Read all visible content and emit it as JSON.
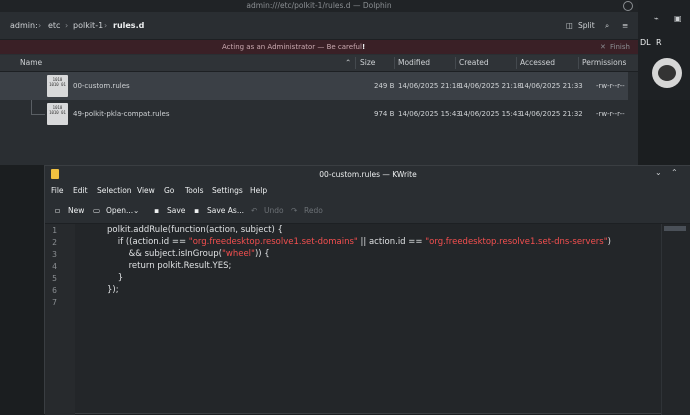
{
  "dolphin": {
    "title": "admin:///etc/polkit-1/rules.d — Dolphin",
    "breadcrumb": [
      "admin:",
      "etc",
      "polkit-1",
      "rules.d"
    ],
    "split_label": "Split",
    "admin_warning": "Acting as an Administrator — Be careful!",
    "finish_label": "Finish",
    "columns": [
      "Name",
      "Size",
      "Modified",
      "Created",
      "Accessed",
      "Permissions"
    ],
    "files": [
      {
        "name": "00-custom.rules",
        "size": "249 B",
        "modified": "14/06/2025 21:18",
        "created": "14/06/2025 21:18",
        "accessed": "14/06/2025 21:33",
        "permissions": "-rw-r--r--",
        "icon_text": "1010 1010 01"
      },
      {
        "name": "49-polkit-pkla-compat.rules",
        "size": "974 B",
        "modified": "14/06/2025 15:43",
        "created": "14/06/2025 15:43",
        "accessed": "14/06/2025 21:32",
        "permissions": "-rw-r--r--",
        "icon_text": "1010 1010 01"
      }
    ]
  },
  "right_panel": {
    "label1": "DL",
    "label2": "R"
  },
  "kwrite": {
    "title": "00-custom.rules — KWrite",
    "menus": [
      "File",
      "Edit",
      "Selection",
      "View",
      "Go",
      "Tools",
      "Settings",
      "Help"
    ],
    "toolbar": {
      "new": "New",
      "open": "Open...",
      "save": "Save",
      "save_as": "Save As...",
      "undo": "Undo",
      "redo": "Redo"
    },
    "line_numbers": [
      "1",
      "2",
      "3",
      "4",
      "5",
      "6",
      "7"
    ],
    "code": {
      "l1": "polkit.addRule(function(action, subject) {",
      "l2a": "    if ((action.id == ",
      "l2s1": "\"org.freedesktop.resolve1.set-domains\"",
      "l2b": " || action.id == ",
      "l2s2": "\"org.freedesktop.resolve1.set-dns-servers\"",
      "l2c": ")",
      "l3a": "        && subject.isInGroup(",
      "l3s": "\"wheel\"",
      "l3b": ")) {",
      "l4": "        return polkit.Result.YES;",
      "l5": "    }",
      "l6": "});",
      "l7": ""
    }
  },
  "colors": {
    "string": "#f44f4f",
    "selection_row": "#3b4046",
    "admin_bar": "#3a2026"
  }
}
